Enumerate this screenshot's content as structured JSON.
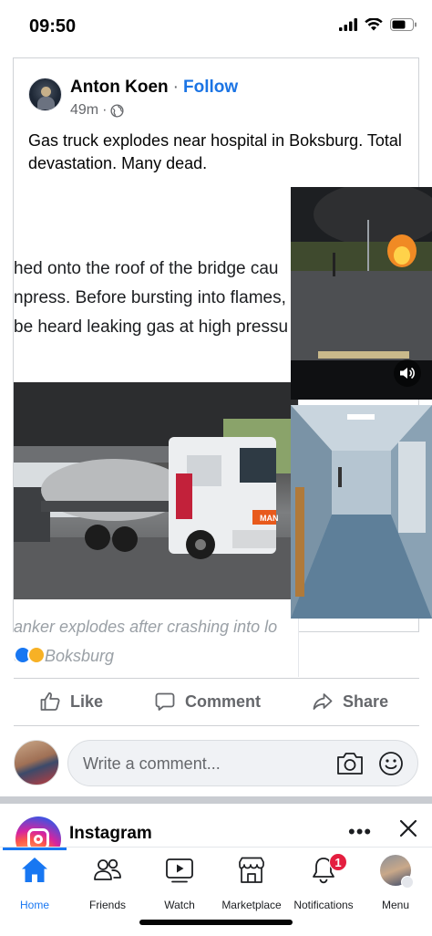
{
  "status_bar": {
    "time": "09:50"
  },
  "post": {
    "author": "Anton Koen",
    "separator": "·",
    "follow_label": "Follow",
    "time_ago": "49m",
    "meta_dot": "·",
    "text": "Gas truck explodes near hospital in Boksburg. Total devastation. Many dead.",
    "article_lines": [
      "hed onto the roof of the bridge cau",
      "npress. Before bursting into flames,",
      "be heard leaking gas at high pressu"
    ],
    "caption_lines": [
      "anker explodes after crashing into lo",
      "e in Boksburg"
    ],
    "truck_plate_text": "MAN"
  },
  "actions": {
    "like": "Like",
    "comment": "Comment",
    "share": "Share"
  },
  "comment_box": {
    "placeholder": "Write a comment..."
  },
  "next_post": {
    "name": "Instagram",
    "more": "•••"
  },
  "tabs": [
    {
      "label": "Home"
    },
    {
      "label": "Friends"
    },
    {
      "label": "Watch"
    },
    {
      "label": "Marketplace"
    },
    {
      "label": "Notifications",
      "badge": "1"
    },
    {
      "label": "Menu"
    }
  ],
  "colors": {
    "accent": "#1877f2",
    "follow": "#1b74e4",
    "badge": "#e41e3f"
  }
}
